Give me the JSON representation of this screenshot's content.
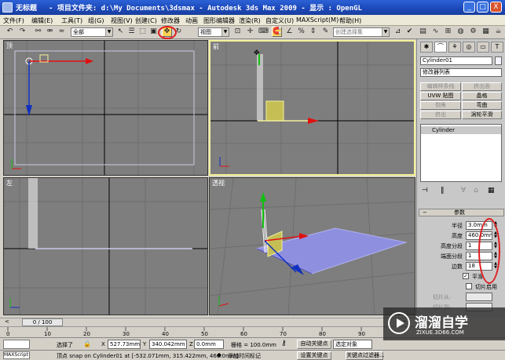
{
  "titlebar": {
    "title": "无标题",
    "project": "- 项目文件夹: d:\\My Documents\\3dsmax    - Autodesk 3ds Max  2009        - 显示 : OpenGL",
    "min": "_",
    "max": "□",
    "close": "X"
  },
  "menu": [
    "文件(F)",
    "编辑(E)",
    "工具(T)",
    "组(G)",
    "视图(V)",
    "创建(C)",
    "修改器",
    "动画",
    "图形编辑器",
    "渲染(R)",
    "自定义(U)",
    "MAXScript(M)",
    "帮助(H)"
  ],
  "toolbar": {
    "selection_filter": "全部",
    "ref_coord": "视图",
    "named_selection": "创建选择集"
  },
  "viewports": {
    "top": "顶",
    "front": "前",
    "left": "左",
    "perspective": "透视"
  },
  "cmdpanel": {
    "object_name": "Cylinder01",
    "modifier_list": "修改器列表",
    "buttons": [
      "编辑样条线",
      "挤出面",
      "UVW 贴图",
      "晶格",
      "倒角",
      "弯曲",
      "挤出",
      "涡轮平滑"
    ],
    "stack_item": "Cylinder",
    "params_title": "参数",
    "params": [
      {
        "label": "半径",
        "value": "3.0mm"
      },
      {
        "label": "高度",
        "value": "460.0mm"
      },
      {
        "label": "高度分段",
        "value": "1"
      },
      {
        "label": "端面分段",
        "value": "1"
      },
      {
        "label": "边数",
        "value": "18"
      }
    ],
    "smooth_label": "平滑",
    "slice_on": "切片启用",
    "slice_from": "切片从:",
    "slice_to": "切片到:"
  },
  "timeslider": {
    "frame": "0 / 100"
  },
  "trackbar": {
    "ticks": [
      "0",
      "10",
      "20",
      "30",
      "40",
      "50",
      "60",
      "70",
      "80",
      "90"
    ]
  },
  "status": {
    "selected": "选择了",
    "x_label": "X",
    "x": "527.73mm",
    "y_label": "Y",
    "y": "340.042mm",
    "z_label": "Z",
    "z": "0.0mm",
    "grid": "栅格 = 100.0mm",
    "autokey": "自动关键点",
    "selected_obj": "选定对象",
    "setkey": "设置关键点",
    "key_filters": "关键点过滤器...",
    "maxscript": "MAXScript",
    "prompt": "顶点 snap on Cylinder01 at [-532.071mm, 315.422mm, 460.0mm]",
    "add_time_tag": "添加时间标记"
  },
  "watermark": {
    "title": "溜溜自学",
    "url": "ZIXUE.3D66.COM"
  },
  "colors": {
    "viewport_bg": "#7e7e7e",
    "active_border": "#f3f19a",
    "highlight_circle": "#e01c1c"
  }
}
